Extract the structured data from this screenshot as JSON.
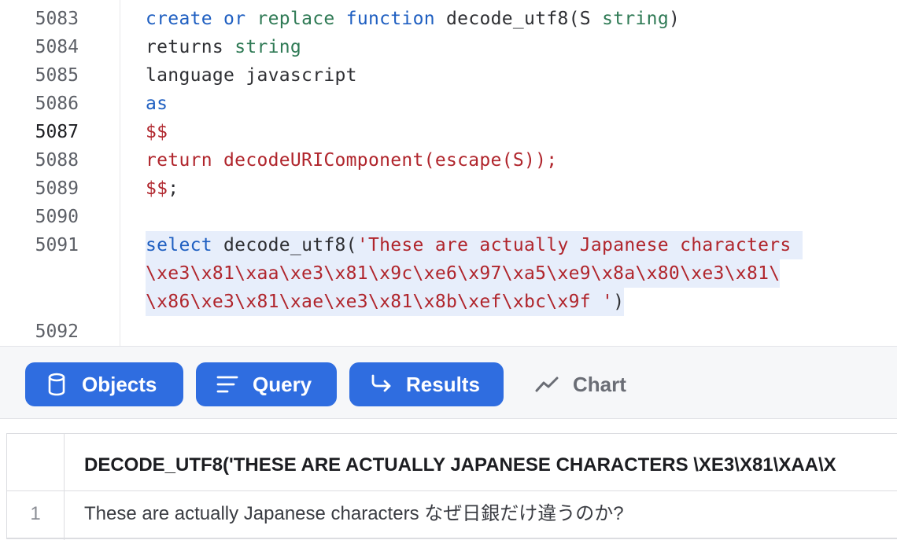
{
  "editor": {
    "lines": [
      {
        "num": "5083",
        "segments": [
          [
            "kw",
            "create"
          ],
          [
            "txt",
            " "
          ],
          [
            "kw",
            "or"
          ],
          [
            "txt",
            " "
          ],
          [
            "ty",
            "replace"
          ],
          [
            "txt",
            " "
          ],
          [
            "kw",
            "function"
          ],
          [
            "txt",
            " decode_utf8(S "
          ],
          [
            "ty",
            "string"
          ],
          [
            "txt",
            ")"
          ]
        ]
      },
      {
        "num": "5084",
        "segments": [
          [
            "txt",
            "returns "
          ],
          [
            "ty",
            "string"
          ]
        ]
      },
      {
        "num": "5085",
        "segments": [
          [
            "txt",
            "language javascript"
          ]
        ]
      },
      {
        "num": "5086",
        "segments": [
          [
            "kw",
            "as"
          ]
        ]
      },
      {
        "num": "5087",
        "active": true,
        "segments": [
          [
            "str",
            "$$"
          ]
        ]
      },
      {
        "num": "5088",
        "segments": [
          [
            "str",
            "return decodeURIComponent(escape(S));"
          ]
        ]
      },
      {
        "num": "5089",
        "segments": [
          [
            "str",
            "$$"
          ],
          [
            "txt",
            ";"
          ]
        ]
      },
      {
        "num": "5090",
        "segments": []
      },
      {
        "num": "5091",
        "highlight": true,
        "segments": [
          [
            "kw",
            "select"
          ],
          [
            "txt",
            " decode_utf8("
          ],
          [
            "str",
            "'These are actually Japanese characters "
          ]
        ]
      },
      {
        "num": "",
        "highlight": true,
        "segments": [
          [
            "str",
            "\\xe3\\x81\\xaa\\xe3\\x81\\x9c\\xe6\\x97\\xa5\\xe9\\x8a\\x80\\xe3\\x81\\"
          ]
        ]
      },
      {
        "num": "",
        "highlight": true,
        "segments": [
          [
            "str",
            "\\x86\\xe3\\x81\\xae\\xe3\\x81\\x8b\\xef\\xbc\\x9f '"
          ],
          [
            "txt",
            ")"
          ]
        ]
      },
      {
        "num": "5092",
        "segments": []
      }
    ]
  },
  "toolbar": {
    "objects_label": "Objects",
    "query_label": "Query",
    "results_label": "Results",
    "chart_label": "Chart"
  },
  "results": {
    "column_header": "DECODE_UTF8('THESE ARE ACTUALLY JAPANESE CHARACTERS \\XE3\\X81\\XAA\\X",
    "rows": [
      {
        "index": "1",
        "value": "These are actually Japanese characters なぜ日銀だけ違うのか?"
      }
    ]
  },
  "colors": {
    "accent": "#2f6de0",
    "keyword": "#1f5fc1",
    "type": "#2f7a55",
    "string": "#b0252c"
  }
}
